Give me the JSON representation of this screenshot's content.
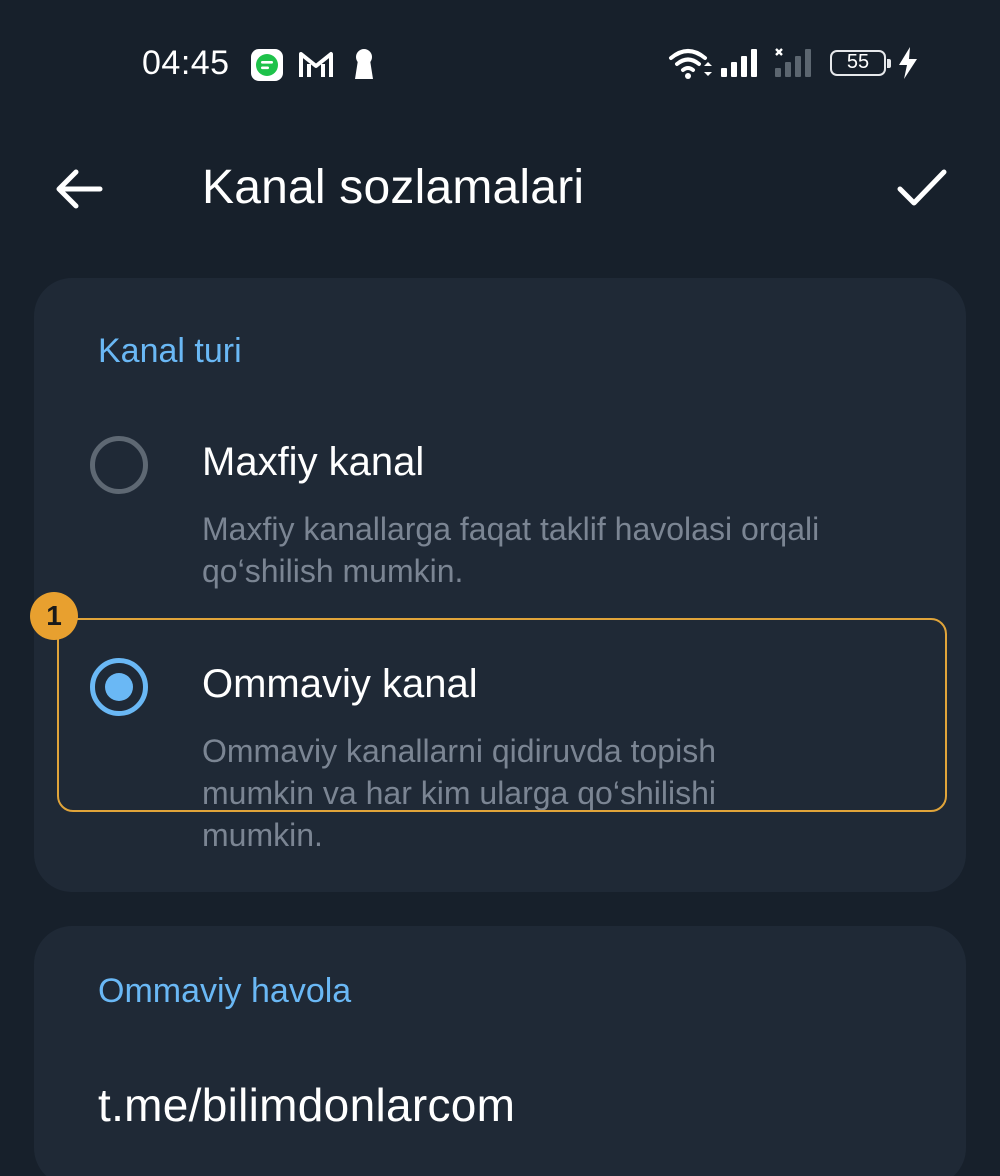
{
  "status_bar": {
    "time": "04:45",
    "battery": "55",
    "icons": [
      "message-app-icon",
      "gmail-icon",
      "keyhole-icon",
      "wifi-icon",
      "signal-icon",
      "signal-no-service-icon",
      "battery-icon",
      "charging-bolt-icon"
    ]
  },
  "header": {
    "title": "Kanal sozlamalari",
    "back_icon": "arrow-left-icon",
    "done_icon": "checkmark-icon"
  },
  "channel_type": {
    "section_title": "Kanal turi",
    "selected": "public",
    "options": [
      {
        "id": "private",
        "label": "Maxfiy kanal",
        "description": "Maxfiy kanallarga faqat taklif havolasi orqali qo‘shilish mumkin."
      },
      {
        "id": "public",
        "label": "Ommaviy kanal",
        "description": "Ommaviy kanallarni qidiruvda topish mumkin va har kim ularga qo‘shilishi mumkin."
      }
    ]
  },
  "annotation": {
    "badge": "1",
    "color": "#e8a02f"
  },
  "public_link": {
    "section_title": "Ommaviy havola",
    "value": "t.me/bilimdonlarcom"
  },
  "colors": {
    "background": "#17202b",
    "card": "#1f2936",
    "accent": "#6ab8f5",
    "secondary_text": "#7b8593"
  }
}
